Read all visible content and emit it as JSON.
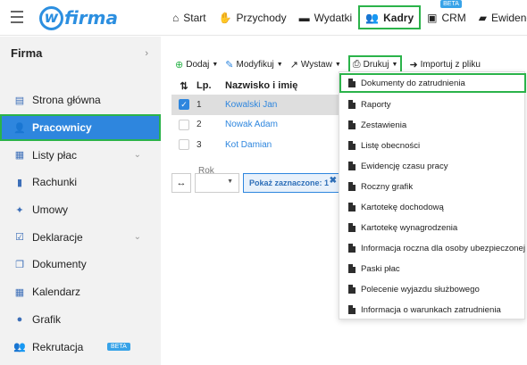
{
  "topbar": {
    "logo_text": "firma",
    "logo_letter": "w",
    "nav": [
      {
        "label": "Start",
        "icon": "home-icon"
      },
      {
        "label": "Przychody",
        "icon": "hand-money-icon"
      },
      {
        "label": "Wydatki",
        "icon": "wallet-icon"
      },
      {
        "label": "Kadry",
        "icon": "users-icon"
      },
      {
        "label": "CRM",
        "icon": "contact-card-icon",
        "badge": "BETA"
      },
      {
        "label": "Ewidencje",
        "icon": "folder-icon"
      }
    ]
  },
  "sidebar": {
    "title": "Firma",
    "items": [
      {
        "label": "Strona główna",
        "icon": "dashboard-icon"
      },
      {
        "label": "Pracownicy",
        "icon": "add-user-icon"
      },
      {
        "label": "Listy płac",
        "icon": "calculator-icon"
      },
      {
        "label": "Rachunki",
        "icon": "document-icon"
      },
      {
        "label": "Umowy",
        "icon": "handshake-icon"
      },
      {
        "label": "Deklaracje",
        "icon": "checklist-icon"
      },
      {
        "label": "Dokumenty",
        "icon": "documents-icon"
      },
      {
        "label": "Kalendarz",
        "icon": "calendar-icon"
      },
      {
        "label": "Grafik",
        "icon": "clock-icon"
      },
      {
        "label": "Rekrutacja",
        "icon": "recruitment-icon",
        "badge": "BETA"
      }
    ]
  },
  "toolbar": {
    "add": "Dodaj",
    "modify": "Modyfikuj",
    "issue": "Wystaw",
    "print": "Drukuj",
    "import": "Importuj z pliku"
  },
  "table": {
    "headers": {
      "sort": "⇅",
      "lp": "Lp.",
      "name": "Nazwisko i imię"
    },
    "rows": [
      {
        "lp": "1",
        "name": "Kowalski Jan",
        "checked": true
      },
      {
        "lp": "2",
        "name": "Nowak Adam",
        "checked": false
      },
      {
        "lp": "3",
        "name": "Kot Damian",
        "checked": false
      }
    ]
  },
  "filter": {
    "year_label": "Rok",
    "year_value": "",
    "show_selected": "Pokaż zaznaczone: 1"
  },
  "print_menu": [
    "Dokumenty do zatrudnienia",
    "Raporty",
    "Zestawienia",
    "Listę obecności",
    "Ewidencję czasu pracy",
    "Roczny grafik",
    "Kartotekę dochodową",
    "Kartotekę wynagrodzenia",
    "Informacja roczna dla osoby ubezpieczonej",
    "Paski płac",
    "Polecenie wyjazdu służbowego",
    "Informacja o warunkach zatrudnienia"
  ],
  "colors": {
    "accent": "#2e86de",
    "highlight": "#2bb34a",
    "sidebar_bg": "#f2f2f2"
  }
}
